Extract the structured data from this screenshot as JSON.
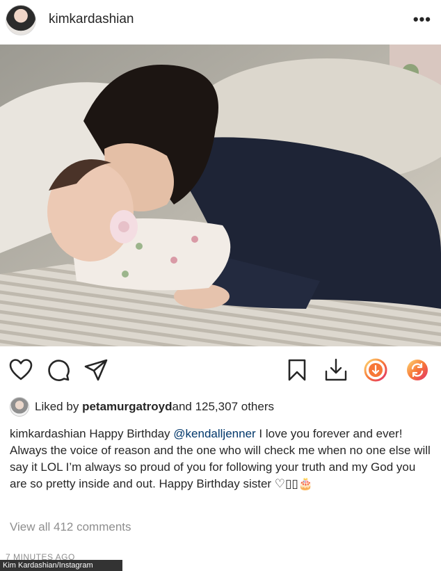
{
  "header": {
    "username": "kimkardashian",
    "more_label": "•••"
  },
  "post": {
    "image_alt": "Photo of a woman kissing a baby with a pacifier on a bed"
  },
  "actions": {
    "icons": [
      "heart-icon",
      "comment-icon",
      "share-icon",
      "bookmark-icon",
      "download-icon",
      "download-circle-icon",
      "repost-icon"
    ]
  },
  "likes": {
    "prefix": "Liked by ",
    "user": "petamurgatroyd",
    "suffix": " and 125,307 others"
  },
  "caption": {
    "username": "kimkardashian",
    "text_before": " Happy Birthday ",
    "mention": "@kendalljenner",
    "text_after": " I love you forever and ever! Always the voice of reason and the one who will check me when no one else will say it LOL I’m always so proud of you for following your truth and my God you are so pretty inside and out. Happy Birthday sister ♡▯▯🎂"
  },
  "comments": {
    "view_all": "View all 412 comments"
  },
  "timestamp": "7 MINUTES AGO",
  "credit": "Kim Kardashian/Instagram",
  "colors": {
    "text": "#262626",
    "muted": "#8e8e8e",
    "mention": "#00376b",
    "accent_orange": "#f77737",
    "accent_pink": "#e1306c"
  }
}
